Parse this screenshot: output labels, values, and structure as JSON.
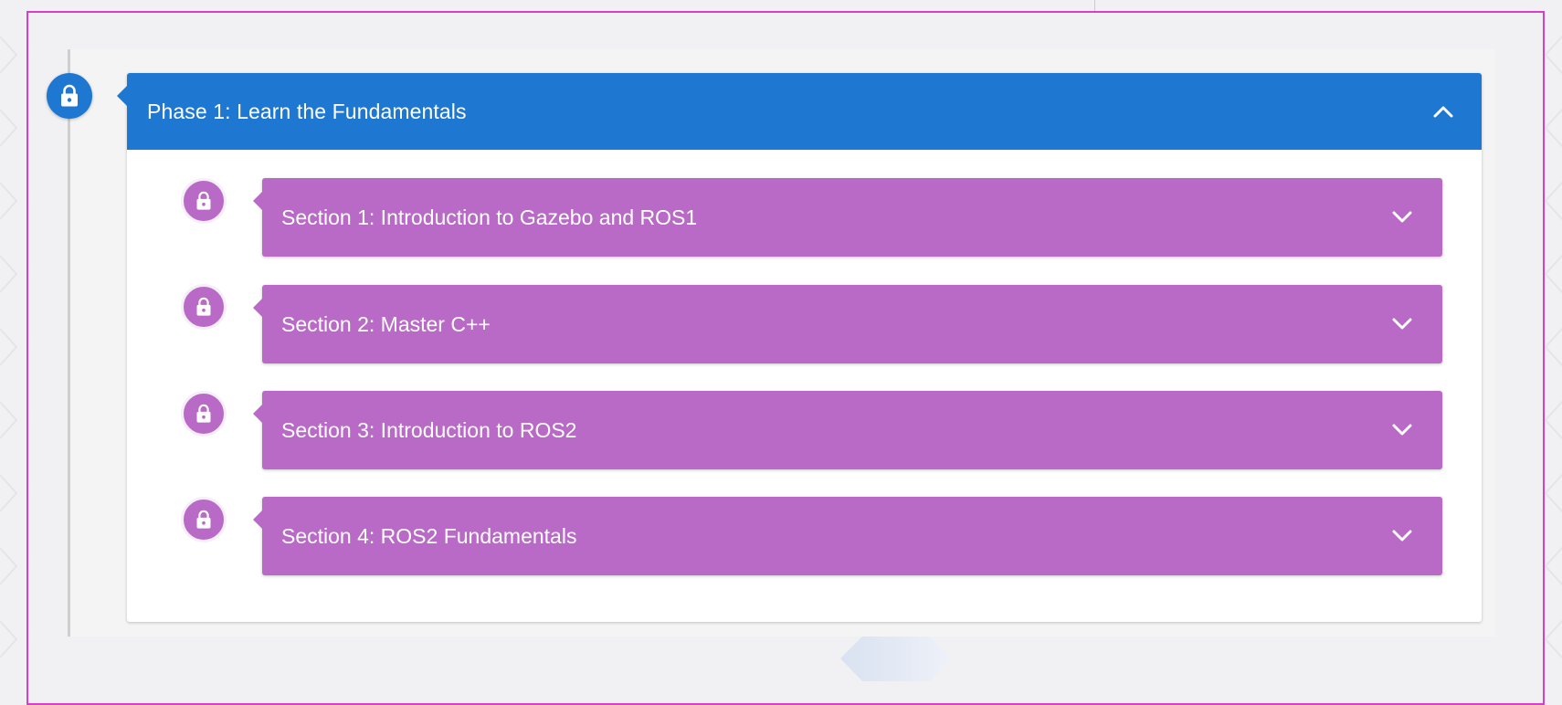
{
  "phase": {
    "title": "Phase 1: Learn the Fundamentals",
    "icon": "lock-icon",
    "toggle_icon": "chevron-up-icon",
    "expanded": true,
    "color": "#1e78d2"
  },
  "sections": [
    {
      "title": "Section 1: Introduction to Gazebo and ROS1",
      "icon": "lock-icon",
      "toggle_icon": "chevron-down-icon"
    },
    {
      "title": "Section 2: Master C++",
      "icon": "lock-icon",
      "toggle_icon": "chevron-down-icon"
    },
    {
      "title": "Section 3: Introduction to ROS2",
      "icon": "lock-icon",
      "toggle_icon": "chevron-down-icon"
    },
    {
      "title": "Section 4: ROS2 Fundamentals",
      "icon": "lock-icon",
      "toggle_icon": "chevron-down-icon"
    }
  ],
  "colors": {
    "phase_header": "#1e78d2",
    "section_bar": "#b86ac6",
    "frame_border": "#d63fc8",
    "text": "#ffffff"
  }
}
